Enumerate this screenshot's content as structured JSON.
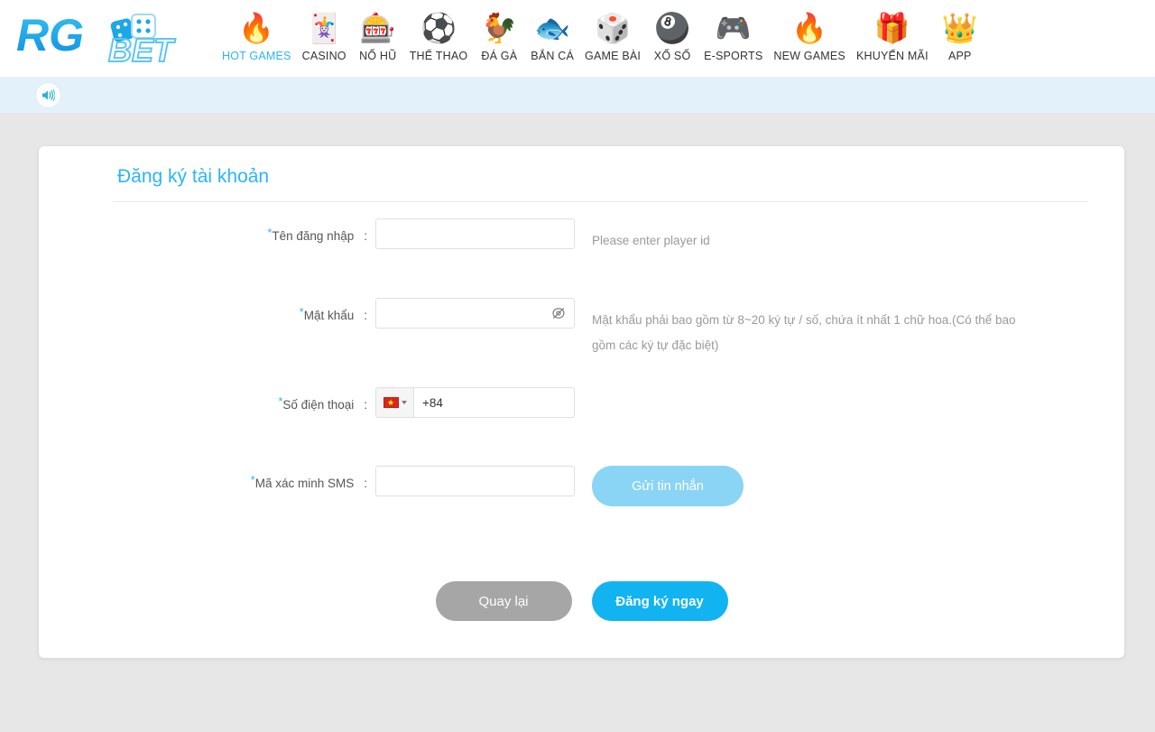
{
  "brand": {
    "name": "RGBET",
    "part1": "RG",
    "part2": "BET",
    "color": "#1ba7e8"
  },
  "nav": {
    "items": [
      {
        "label": "HOT GAMES",
        "icon": "flame-icon",
        "glyph": "🔥",
        "active": true
      },
      {
        "label": "CASINO",
        "icon": "casino-icon",
        "glyph": "🃏",
        "active": false
      },
      {
        "label": "NỔ HŨ",
        "icon": "slot-machine-icon",
        "glyph": "🎰",
        "active": false
      },
      {
        "label": "THỂ THAO",
        "icon": "soccer-ball-icon",
        "glyph": "⚽",
        "active": false
      },
      {
        "label": "ĐÁ GÀ",
        "icon": "rooster-icon",
        "glyph": "🐓",
        "active": false
      },
      {
        "label": "BẮN CÁ",
        "icon": "fish-icon",
        "glyph": "🐟",
        "active": false
      },
      {
        "label": "GAME BÀI",
        "icon": "dice-icon",
        "glyph": "🎲",
        "active": false
      },
      {
        "label": "XỔ SỐ",
        "icon": "lottery-ball-icon",
        "glyph": "🎱",
        "active": false
      },
      {
        "label": "E-SPORTS",
        "icon": "gamepad-icon",
        "glyph": "🎮",
        "active": false
      },
      {
        "label": "NEW GAMES",
        "icon": "flame-icon",
        "glyph": "🔥",
        "active": false
      },
      {
        "label": "KHUYẾN MÃI",
        "icon": "gift-icon",
        "glyph": "🎁",
        "active": false
      },
      {
        "label": "APP",
        "icon": "crown-icon",
        "glyph": "👑",
        "active": false
      }
    ]
  },
  "notice": {
    "icon": "speaker-icon",
    "text": ""
  },
  "card": {
    "title": "Đăng ký tài khoản",
    "fields": {
      "username": {
        "label": "Tên đăng nhập",
        "required": "*",
        "colon": ":",
        "value": "",
        "placeholder": "",
        "hint": "Please enter player id"
      },
      "password": {
        "label": "Mật khẩu",
        "required": "*",
        "colon": ":",
        "value": "",
        "placeholder": "",
        "hint": "Mật khẩu phải bao gồm từ 8~20 ký tự / số, chứa ít nhất 1 chữ hoa.(Có thể bao gồm các ký tự đặc biệt)",
        "toggle_icon": "eye-off-icon"
      },
      "phone": {
        "label": "Số điện thoại",
        "required": "*",
        "colon": ":",
        "country_flag": "vietnam-flag-icon",
        "flag_star": "★",
        "value": "+84",
        "placeholder": ""
      },
      "sms": {
        "label": "Mã xác minh SMS",
        "required": "*",
        "colon": ":",
        "value": "",
        "placeholder": "",
        "send_button": "Gửi tin nhắn"
      }
    },
    "actions": {
      "back": "Quay lại",
      "submit": "Đăng ký ngay"
    }
  },
  "colors": {
    "accent": "#11b4f0",
    "title": "#29b6f6",
    "sms_button": "#8ad4f5",
    "back_button": "#a6a6a6",
    "notice_bar": "#e3f1fa",
    "page_bg": "#e7e7e7"
  }
}
